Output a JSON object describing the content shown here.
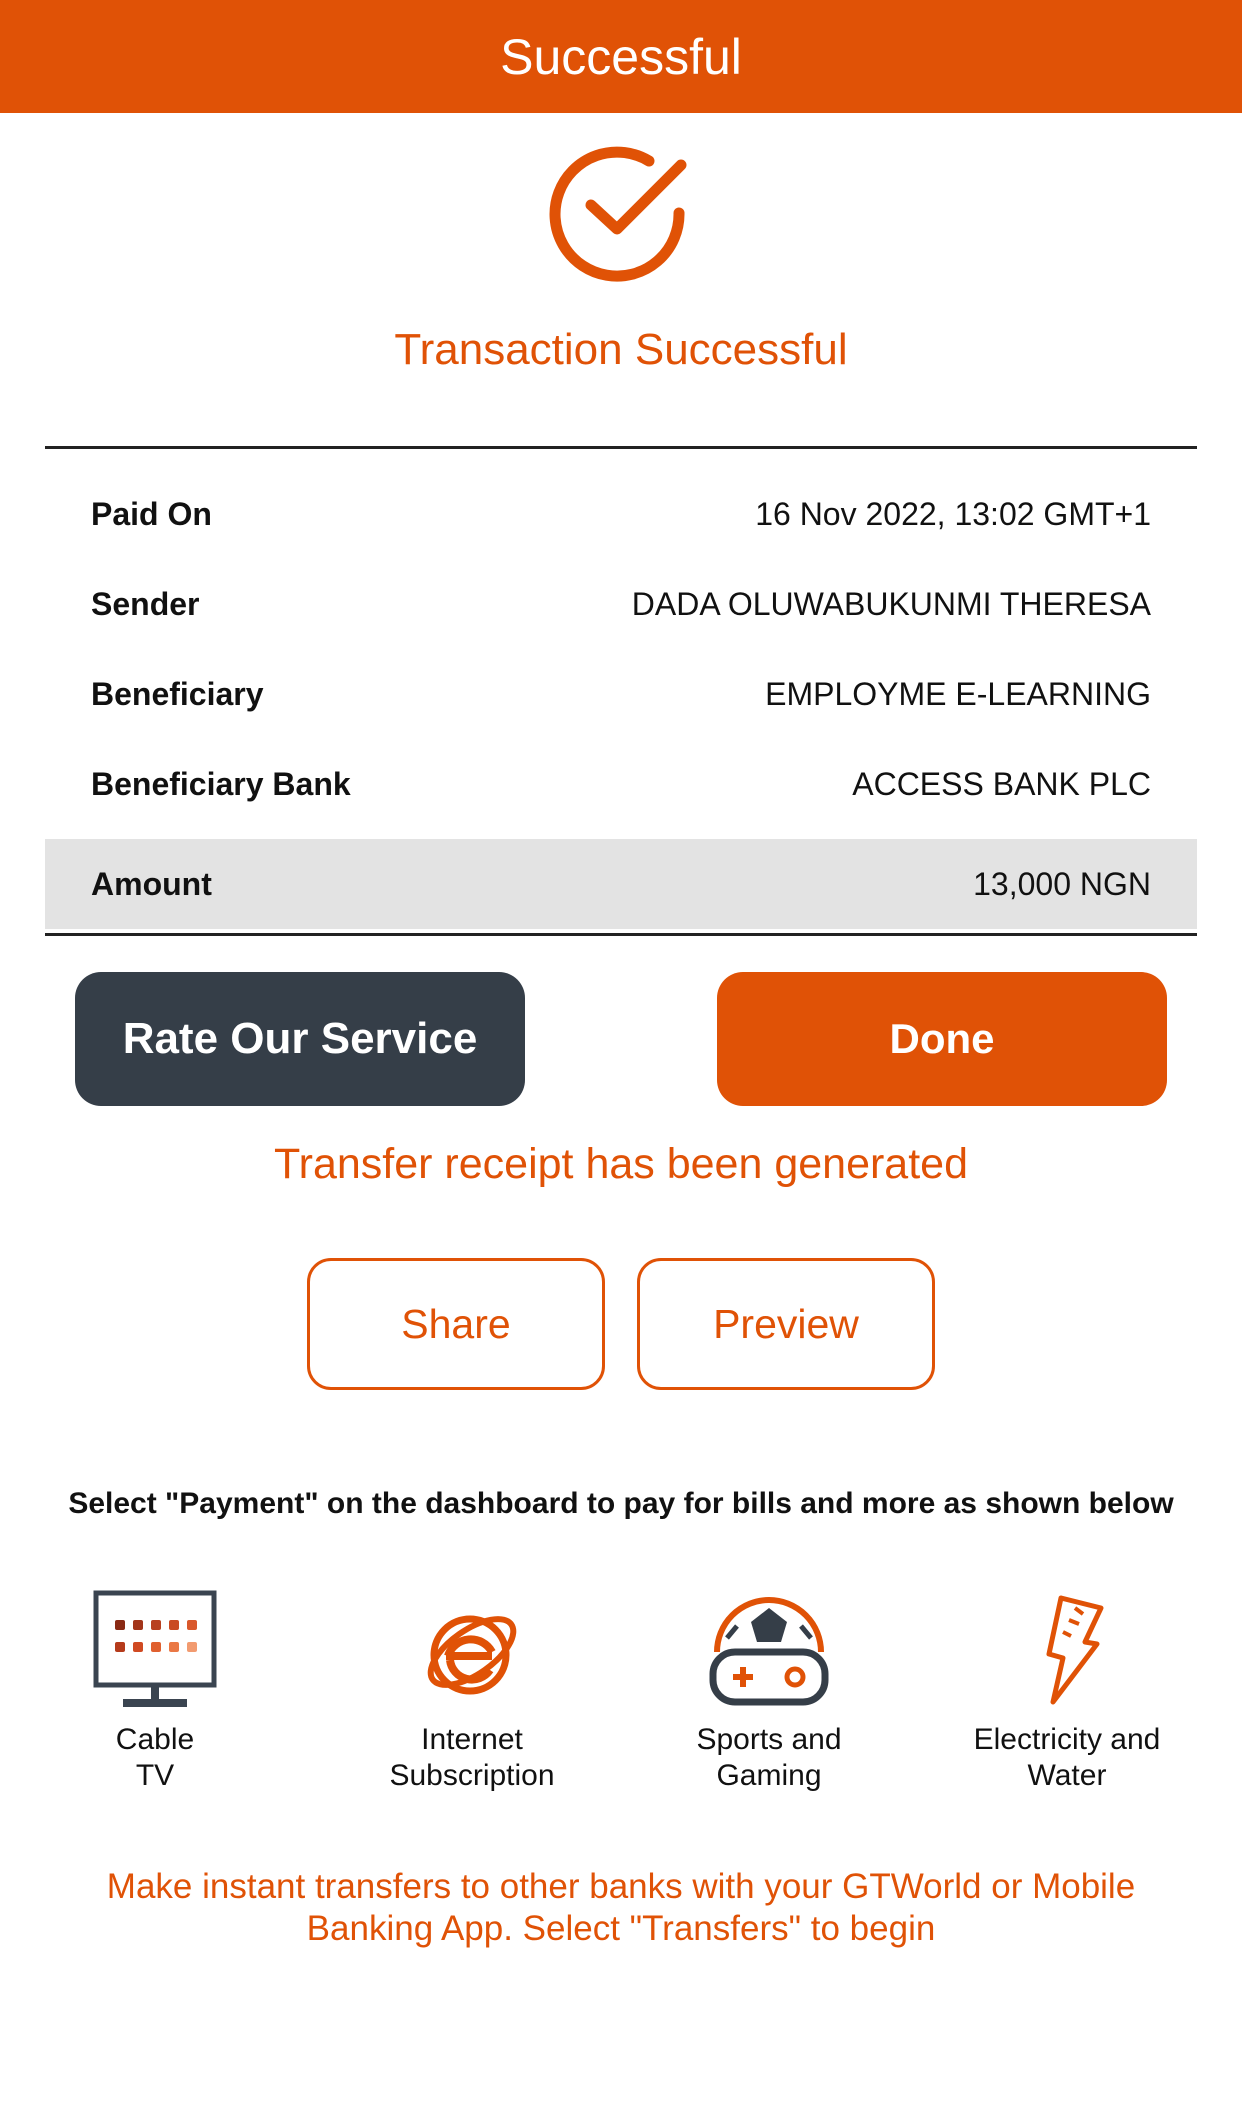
{
  "header": {
    "title": "Successful"
  },
  "status": {
    "title": "Transaction Successful",
    "icon": "check-circle-icon"
  },
  "details": {
    "rows": [
      {
        "label": "Paid On",
        "value": "16 Nov 2022, 13:02 GMT+1"
      },
      {
        "label": "Sender",
        "value": "DADA OLUWABUKUNMI THERESA"
      },
      {
        "label": "Beneficiary",
        "value": "EMPLOYME E-LEARNING"
      },
      {
        "label": "Beneficiary Bank",
        "value": "ACCESS BANK PLC"
      },
      {
        "label": "Amount",
        "value": "13,000 NGN"
      }
    ]
  },
  "actions": {
    "rate_label": "Rate Our Service",
    "done_label": "Done"
  },
  "receipt": {
    "message": "Transfer receipt has been generated",
    "share_label": "Share",
    "preview_label": "Preview"
  },
  "info": {
    "text": "Select \"Payment\" on the dashboard to pay for bills and more as shown below"
  },
  "services": [
    {
      "label": "Cable\nTV",
      "icon": "tv-icon"
    },
    {
      "label": "Internet\nSubscription",
      "icon": "internet-explorer-icon"
    },
    {
      "label": "Sports and\nGaming",
      "icon": "gamepad-ball-icon"
    },
    {
      "label": "Electricity and\nWater",
      "icon": "lightning-icon"
    }
  ],
  "promo": {
    "text": "Make instant transfers to other banks with your GTWorld or Mobile Banking App. Select \"Transfers\" to begin"
  },
  "colors": {
    "brand": "#E05206",
    "dark_button": "#353E48",
    "highlight_row": "#e3e3e3"
  }
}
